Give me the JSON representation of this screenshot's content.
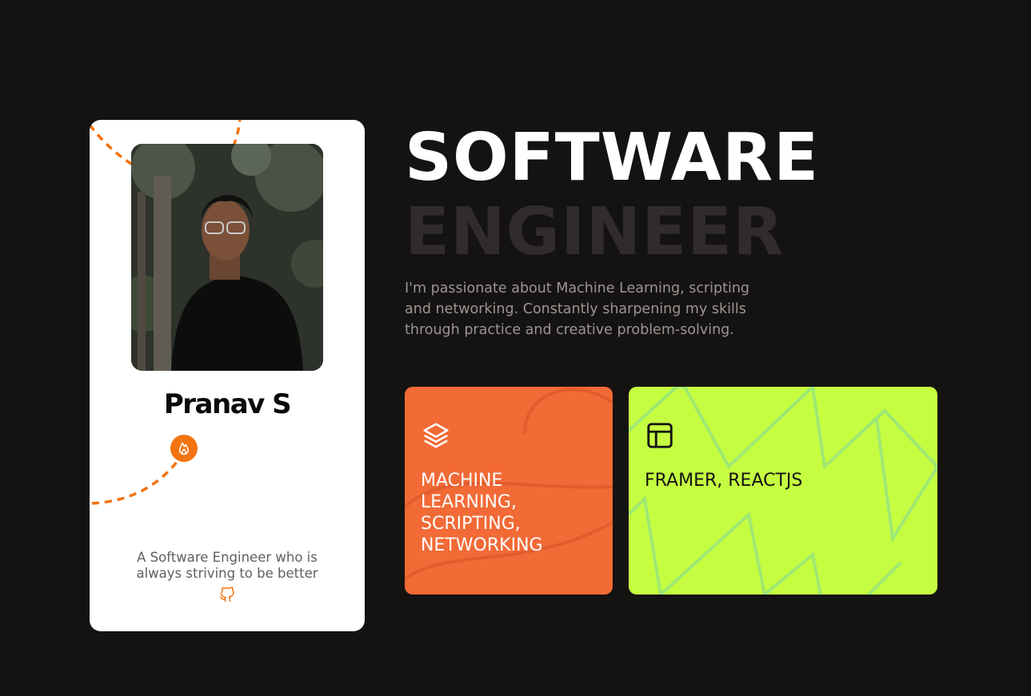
{
  "profile": {
    "name": "Pranav S",
    "tagline": "A Software Engineer who is always striving to be better",
    "badge_icon": "fire-icon",
    "link_icon": "github-icon",
    "accent_color": "#f37310"
  },
  "hero": {
    "headline_primary": "SOFTWARE",
    "headline_secondary": "ENGINEER",
    "bio": "I'm passionate about Machine Learning, scripting and networking. Constantly sharpening my skills through practice and creative problem-solving."
  },
  "skills": [
    {
      "icon": "layers-icon",
      "title": "MACHINE LEARNING, SCRIPTING, NETWORKING",
      "color": "#f26a36"
    },
    {
      "icon": "layout-icon",
      "title": "FRAMER, REACTJS",
      "color": "#c5fe41"
    }
  ],
  "colors": {
    "background": "#151312",
    "card": "#ffffff"
  }
}
